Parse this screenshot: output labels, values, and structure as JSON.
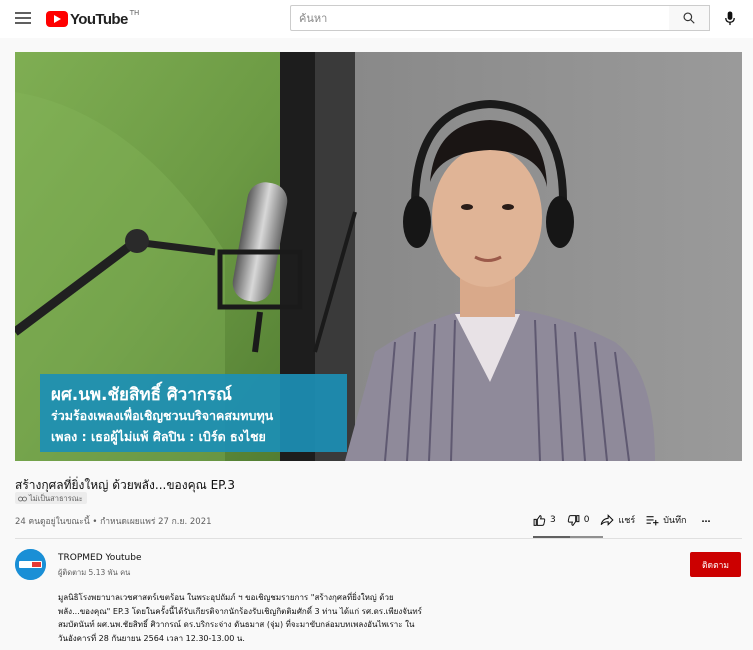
{
  "header": {
    "logo_text": "YouTube",
    "logo_region": "TH",
    "search_placeholder": "ค้นหา"
  },
  "video": {
    "overlay_lines": [
      "ผศ.นพ.ชัยสิทธิ์ ศิวากรณ์",
      "ร่วมร้องเพลงเพื่อเชิญชวนบริจาคสมทบทุน",
      "เพลง : เธอผู้ไม่แพ้  ศิลปิน : เบิร์ด ธงไชย"
    ],
    "title": "สร้างกุศลที่ยิ่งใหญ่ ด้วยพลัง...ของคุณ EP.3",
    "badge": "ไม่เป็นสาธารณะ",
    "meta": "24 คนดูอยู่ในขณะนี้ • กำหนดเผยแพร่ 27 ก.ย. 2021",
    "likes": "3",
    "dislikes": "0",
    "share_label": "แชร์",
    "save_label": "บันทึก",
    "more_label": "…"
  },
  "channel": {
    "name": "TROPMED Youtube",
    "subscribers": "ผู้ติดตาม 5.13 พัน คน",
    "subscribe_label": "ติดตาม",
    "avatar_color": "#1a8fd6"
  },
  "description": {
    "lines": [
      "มูลนิธิโรงพยาบาลเวชศาสตร์เขตร้อน ในพระอุปถัมภ์ ฯ ขอเชิญชมรายการ \"สร้างกุศลที่ยิ่งใหญ่ ด้วย",
      "พลัง...ของคุณ\" EP.3 โดยในครั้งนี้ได้รับเกียรติจากนักร้องรับเชิญกิตติมศักดิ์ 3 ท่าน ได้แก่ รศ.ดร.เพียงจันทร์",
      "สมบัตนันท์ ผศ.นพ.ชัยสิทธิ์ ศิวากรณ์ ดร.บริกระจ่าง ดันธมาส (จุ่ม) ที่จะมาขับกล่อมบทเพลงอันไพเราะ ใน",
      "วันอังคารที่ 28 กันยายน 2564 เวลา 12.30-13.00 น."
    ]
  },
  "colors": {
    "accent": "#ff0000",
    "subscribe": "#cc0000",
    "overlay_box": "#1c8fb5"
  }
}
